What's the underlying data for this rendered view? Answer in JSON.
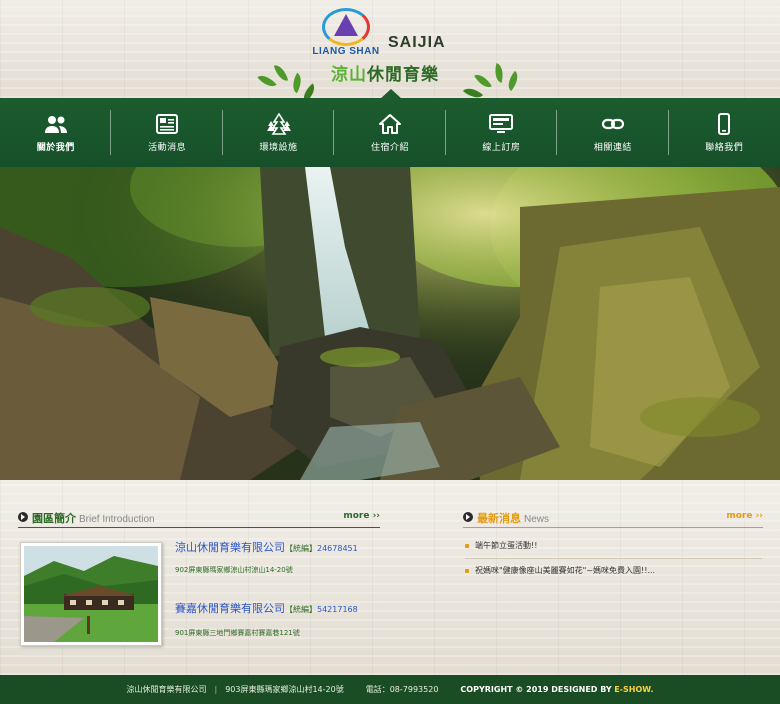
{
  "header": {
    "logo_liangshan_text": "LIANG SHAN",
    "logo_saijia_text": "SAIJIA",
    "title_part1": "涼山",
    "title_part2": "休閒育樂"
  },
  "nav": [
    {
      "label": "關於我們",
      "icon": "users-icon",
      "active": true
    },
    {
      "label": "活動消息",
      "icon": "newspaper-icon",
      "active": false
    },
    {
      "label": "環境設施",
      "icon": "trees-icon",
      "active": false
    },
    {
      "label": "住宿介紹",
      "icon": "home-icon",
      "active": false
    },
    {
      "label": "線上訂房",
      "icon": "monitor-icon",
      "active": false
    },
    {
      "label": "相關連結",
      "icon": "link-icon",
      "active": false
    },
    {
      "label": "聯絡我們",
      "icon": "phone-icon",
      "active": false
    }
  ],
  "intro": {
    "title": "園區簡介",
    "subtitle": "Brief Introduction",
    "more": "more ››",
    "companies": [
      {
        "name": "涼山休閒育樂有限公司",
        "tag": "【統編】",
        "number": "24678451",
        "address": "902屏東縣瑪家鄉涼山村涼山14-20號"
      },
      {
        "name": "賽嘉休閒育樂有限公司",
        "tag": "【統編】",
        "number": "54217168",
        "address": "901屏東縣三地門鄉賽嘉村賽嘉巷121號"
      }
    ]
  },
  "news": {
    "title": "最新消息",
    "subtitle": "News",
    "more": "more ››",
    "items": [
      "端午節立蛋活動!!",
      "祝媽咪\"健康像座山美麗賽如花\"~媽咪免費入園!!..."
    ]
  },
  "footer": {
    "company": "涼山休閒育樂有限公司",
    "address": "903屏東縣瑪家鄉涼山村14-20號",
    "phone_label": "電話：",
    "phone": "08-7993520",
    "copyright": "COPYRIGHT © 2019 DESIGNED BY",
    "designer": "E-SHOW."
  },
  "colors": {
    "nav_green": "#1c5c2e",
    "footer_green": "#1a4d24",
    "accent_orange": "#e49b13",
    "link_blue": "#2b55c7",
    "title_green": "#2e6c26"
  }
}
